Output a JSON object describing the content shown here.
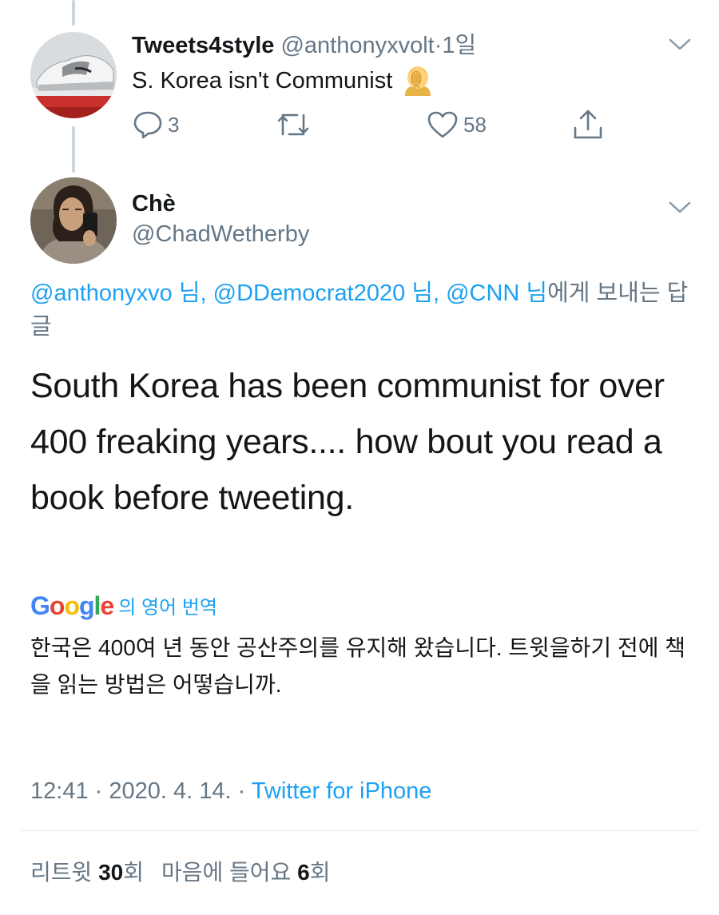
{
  "tweet1": {
    "name": "Tweets4style",
    "handle": "@anthonyxvolt",
    "separator": "·",
    "time": "1일",
    "text": "S. Korea isn't Communist",
    "emoji": "facepalm",
    "reply_count": "3",
    "like_count": "58"
  },
  "tweet2": {
    "name": "Chè",
    "handle": "@ChadWetherby",
    "reply_mentions": [
      "@anthonyxvo 님,",
      "@DDemocrat2020 님,",
      "@CNN 님"
    ],
    "reply_suffix": "에게 보내는 답글",
    "text": "South Korea has been communist for over 400 freaking years.... how bout you read a book before tweeting.",
    "translate_brand": "Google",
    "translate_label": "의 영어 번역",
    "translated_text": "한국은 400여 년 동안 공산주의를 유지해 왔습니다. 트윗을하기 전에 책을 읽는 방법은 어떻습니까.",
    "meta_time": "12:41 · 2020. 4. 14. · ",
    "source": "Twitter for iPhone",
    "retweets_label": "리트윗",
    "retweets_count": "30",
    "retweets_unit": "회",
    "likes_label": "마음에 들어요",
    "likes_count": "6",
    "likes_unit": "회"
  },
  "colors": {
    "text": "#14171a",
    "secondary": "#657786",
    "link": "#1da1f2",
    "divider": "#e1e8ed",
    "thread_line": "#ccd6dd"
  },
  "icons": [
    "reply-icon",
    "retweet-icon",
    "like-icon",
    "share-icon",
    "chevron-down-icon",
    "facepalm-emoji"
  ]
}
